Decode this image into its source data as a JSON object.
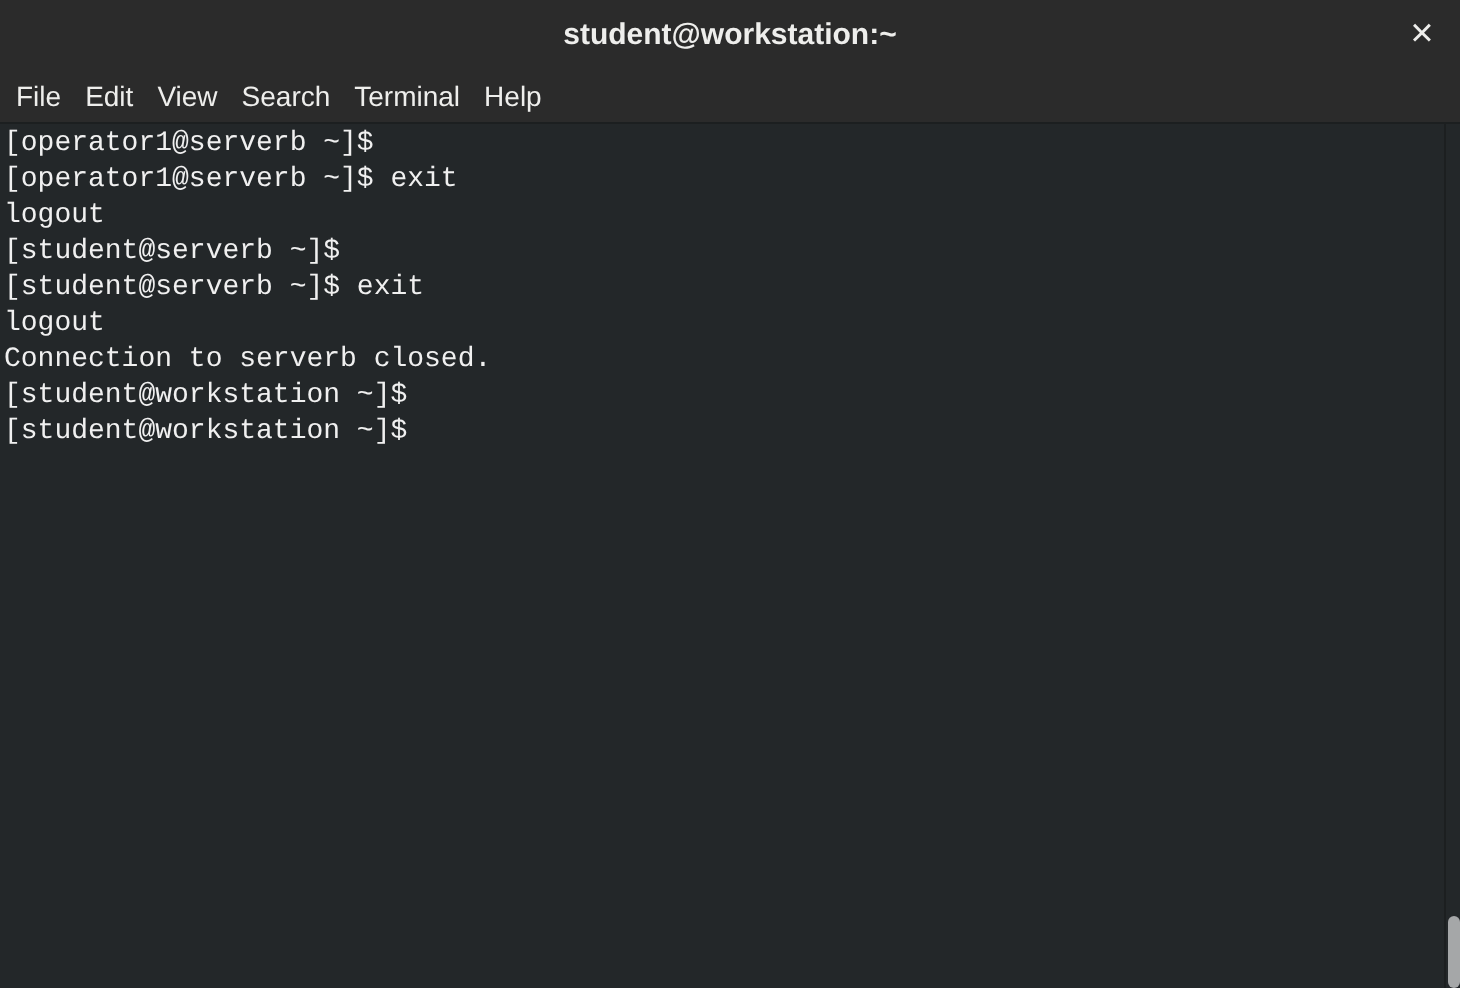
{
  "window": {
    "title": "student@workstation:~",
    "close": "×"
  },
  "menu": [
    "File",
    "Edit",
    "View",
    "Search",
    "Terminal",
    "Help"
  ],
  "terminal": {
    "lines": [
      "[operator1@serverb ~]$",
      "[operator1@serverb ~]$ exit",
      "logout",
      "[student@serverb ~]$",
      "[student@serverb ~]$ exit",
      "logout",
      "Connection to serverb closed.",
      "[student@workstation ~]$",
      "[student@workstation ~]$"
    ]
  }
}
